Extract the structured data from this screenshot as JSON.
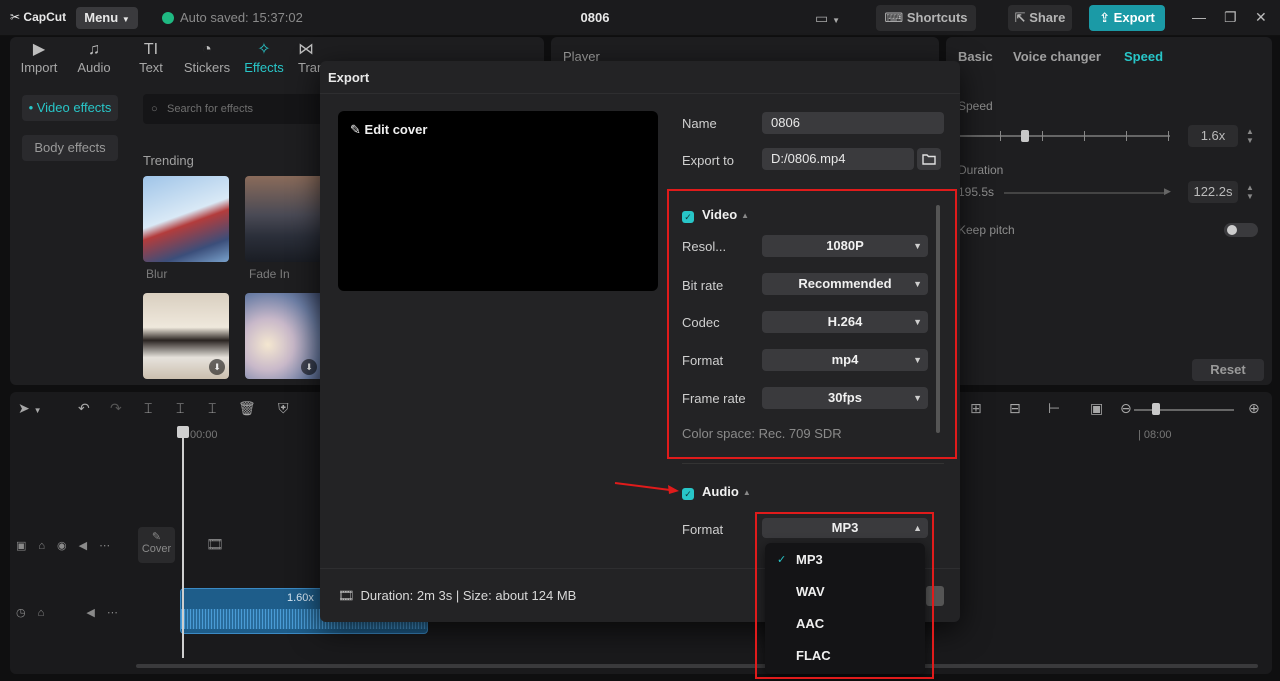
{
  "app": {
    "logo": "CapCut",
    "menu_label": "Menu",
    "autosave": "Auto saved: 15:37:02",
    "project_title": "0806",
    "shortcuts_label": "Shortcuts",
    "share_label": "Share",
    "export_label": "Export"
  },
  "media_toolbar": {
    "tabs": [
      {
        "label": "Import",
        "icon": "import-icon"
      },
      {
        "label": "Audio",
        "icon": "audio-icon"
      },
      {
        "label": "Text",
        "icon": "text-icon"
      },
      {
        "label": "Stickers",
        "icon": "stickers-icon"
      },
      {
        "label": "Effects",
        "icon": "effects-icon"
      },
      {
        "label": "Trar",
        "icon": "transitions-icon"
      }
    ],
    "active": "Effects"
  },
  "effects_panel": {
    "side_items": [
      "• Video effects",
      "Body effects"
    ],
    "search_placeholder": "Search for effects",
    "trending_label": "Trending",
    "thumbs": [
      {
        "label": "Blur"
      },
      {
        "label": "Fade In"
      },
      {
        "label": ""
      },
      {
        "label": ""
      }
    ]
  },
  "player": {
    "title": "Player"
  },
  "right_panel": {
    "tabs": [
      "Basic",
      "Voice changer",
      "Speed"
    ],
    "active_tab": "Speed",
    "speed_label": "Speed",
    "speed_value": "1.6x",
    "speed_level": 0.45,
    "duration_label": "Duration",
    "duration_source": "195.5s",
    "duration_value": "122.2s",
    "keep_pitch_label": "Keep pitch",
    "reset_label": "Reset"
  },
  "timeline": {
    "ruler_start": "00:00",
    "ruler_mark": "08:00",
    "cover_label": "Cover",
    "clip_speed": "1.60x"
  },
  "export_dialog": {
    "title": "Export",
    "edit_cover_label": "Edit cover",
    "name_label": "Name",
    "name_value": "0806",
    "export_to_label": "Export to",
    "export_to_value": "D:/0806.mp4",
    "video": {
      "title": "Video",
      "enabled": true,
      "fields": [
        {
          "label": "Resol...",
          "value": "1080P"
        },
        {
          "label": "Bit rate",
          "value": "Recommended"
        },
        {
          "label": "Codec",
          "value": "H.264"
        },
        {
          "label": "Format",
          "value": "mp4"
        },
        {
          "label": "Frame rate",
          "value": "30fps"
        }
      ],
      "color_space": "Color space: Rec. 709 SDR"
    },
    "audio": {
      "title": "Audio",
      "enabled": true,
      "format_label": "Format",
      "format_value": "MP3",
      "format_options": [
        "MP3",
        "WAV",
        "AAC",
        "FLAC"
      ],
      "selected_option": "MP3"
    },
    "footer": "Duration: 2m 3s | Size: about 124 MB"
  },
  "colors": {
    "accent": "#28c6c8",
    "annotation": "#e01b1b",
    "export_button": "#1b9aa6",
    "autosave_dot": "#1fb982"
  }
}
